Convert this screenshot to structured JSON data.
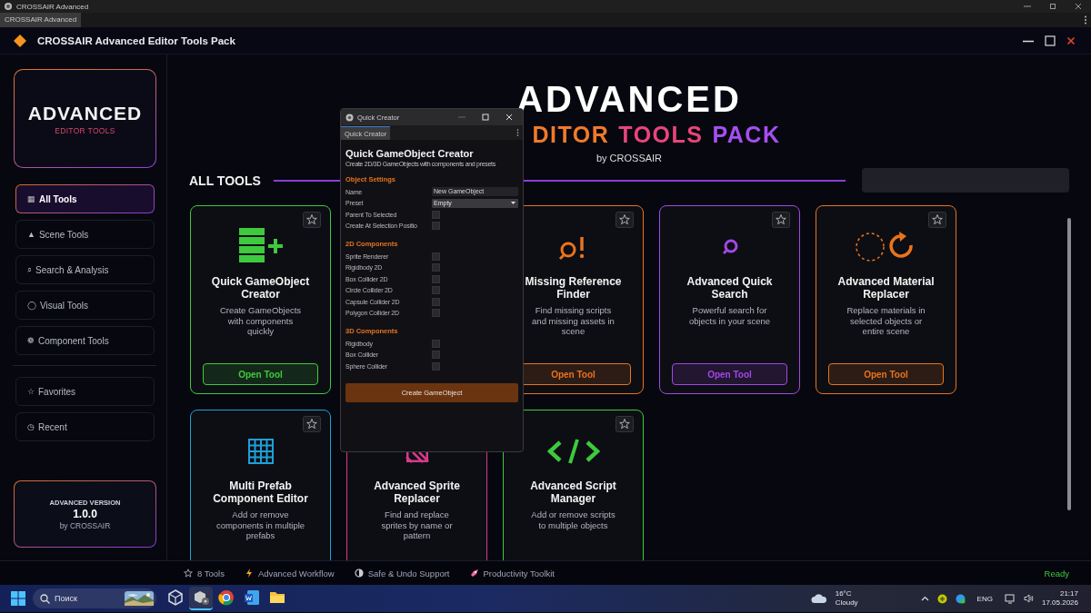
{
  "os_window": {
    "title": "CROSSAIR Advanced"
  },
  "editor_tabs": [
    {
      "label": "CROSSAIR Advanced",
      "selected": true
    }
  ],
  "app": {
    "title": "CROSSAIR Advanced Editor Tools Pack"
  },
  "sidebar": {
    "logo": {
      "title": "ADVANCED",
      "subtitle": "EDITOR TOOLS"
    },
    "items": [
      {
        "icon": "▦",
        "label": "All Tools",
        "selected": true
      },
      {
        "icon": "▲",
        "label": "Scene Tools",
        "selected": false
      },
      {
        "icon": "⌕",
        "label": "Search & Analysis",
        "selected": false
      },
      {
        "icon": "◯",
        "label": "Visual Tools",
        "selected": false
      },
      {
        "icon": "❁",
        "label": "Component Tools",
        "selected": false
      }
    ],
    "secondary_items": [
      {
        "icon": "☆",
        "label": "Favorites",
        "selected": false
      },
      {
        "icon": "◷",
        "label": "Recent",
        "selected": false
      }
    ],
    "version_card": {
      "heading": "ADVANCED VERSION",
      "version": "1.0.0",
      "author": "by CROSSAIR"
    }
  },
  "hero": {
    "title": "ADVANCED",
    "subtitle": [
      {
        "text": "DITOR",
        "color": "#f07a2a"
      },
      {
        "text": "TOOLS",
        "color": "#e8457a"
      },
      {
        "text": "PACK",
        "color": "#a64ef0"
      }
    ],
    "byline": "by CROSSAIR"
  },
  "section": {
    "title": "ALL TOOLS"
  },
  "tools": [
    {
      "title": "Quick GameObject Creator",
      "description": "Create GameObjects with components quickly",
      "button": "Open Tool",
      "color": "#3ec93e"
    },
    {
      "title": "Missing Reference Finder",
      "description": "Find missing scripts and missing assets in scene",
      "button": "Open Tool",
      "color": "#e8731e"
    },
    {
      "title": "Advanced Quick Search",
      "description": "Powerful search for objects in your scene",
      "button": "Open Tool",
      "color": "#a347e8"
    },
    {
      "title": "Advanced Material Replacer",
      "description": "Replace materials in selected objects or entire scene",
      "button": "Open Tool",
      "color": "#e8731e"
    },
    {
      "title": "Multi Prefab Component Editor",
      "description": "Add or remove components in multiple prefabs",
      "color": "#1ea0d8"
    },
    {
      "title": "Advanced Sprite Replacer",
      "description": "Find and replace sprites by name or pattern",
      "color": "#d63a8a"
    },
    {
      "title": "Advanced Script Manager",
      "description": "Add or remove scripts to multiple objects",
      "color": "#3ec93e"
    }
  ],
  "quick_creator": {
    "title": "Quick Creator",
    "tab": {
      "label": "Quick Creator",
      "selected": true
    },
    "heading": "Quick GameObject Creator",
    "subheading": "Create 2D/3D GameObjects with components and presets",
    "sections": [
      {
        "title": "Object Settings",
        "rows": [
          {
            "kind": "text",
            "label": "Name",
            "value": "New GameObject"
          },
          {
            "kind": "dropdown",
            "label": "Preset",
            "value": "Empty"
          },
          {
            "kind": "checkbox",
            "label": "Parent To Selected",
            "checked": false
          },
          {
            "kind": "checkbox",
            "label": "Create At Selection Positio",
            "checked": false
          }
        ]
      },
      {
        "title": "2D Components",
        "rows": [
          {
            "kind": "checkbox",
            "label": "Sprite Renderer",
            "checked": false
          },
          {
            "kind": "checkbox",
            "label": "Rigidbody 2D",
            "checked": false
          },
          {
            "kind": "checkbox",
            "label": "Box Collider 2D",
            "checked": false
          },
          {
            "kind": "checkbox",
            "label": "Circle Collider 2D",
            "checked": false
          },
          {
            "kind": "checkbox",
            "label": "Capsule Collider 2D",
            "checked": false
          },
          {
            "kind": "checkbox",
            "label": "Polygon Collider 2D",
            "checked": false
          }
        ]
      },
      {
        "title": "3D Components",
        "rows": [
          {
            "kind": "checkbox",
            "label": "Rigidbody",
            "checked": false
          },
          {
            "kind": "checkbox",
            "label": "Box Collider",
            "checked": false
          },
          {
            "kind": "checkbox",
            "label": "Sphere Collider",
            "checked": false
          }
        ]
      }
    ],
    "button": "Create GameObject"
  },
  "status_bar": {
    "items": [
      "8 Tools",
      "Advanced Workflow",
      "Safe & Undo Support",
      "Productivity Toolkit"
    ],
    "status": "Ready"
  },
  "taskbar": {
    "search_placeholder": "Поиск",
    "apps": [
      {
        "selected": false
      },
      {
        "selected": true
      },
      {
        "selected": false
      },
      {
        "selected": false
      },
      {
        "selected": false
      }
    ],
    "weather": {
      "temperature": "16°C",
      "condition": "Cloudy"
    },
    "language": "ENG",
    "time": "21:17",
    "date": "17.05.2026"
  }
}
